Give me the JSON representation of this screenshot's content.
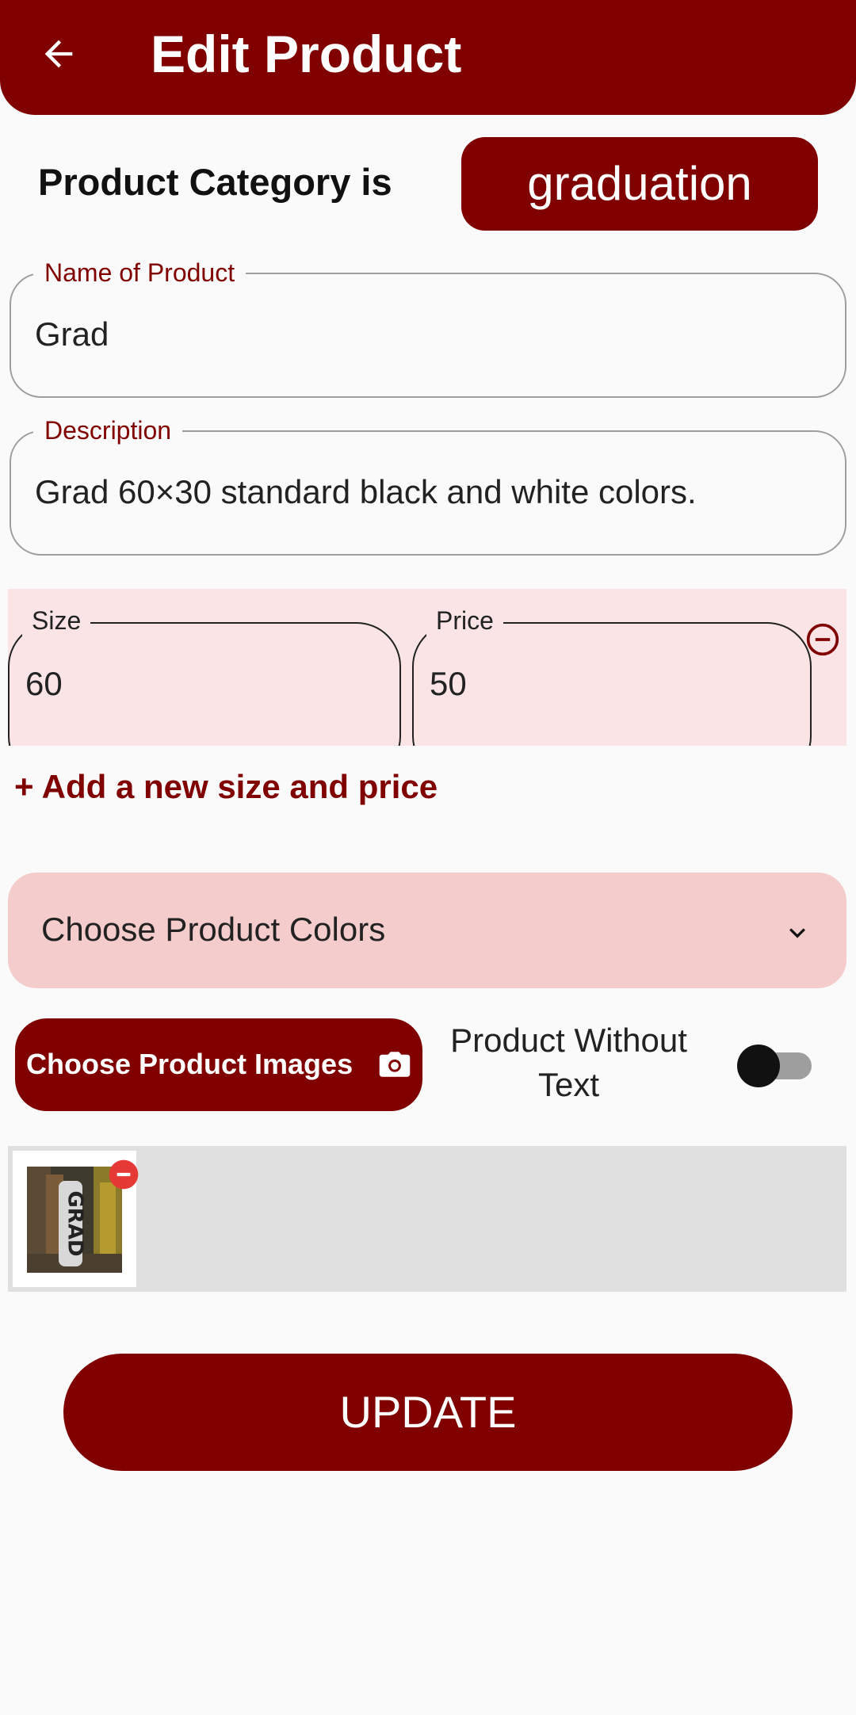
{
  "appbar": {
    "title": "Edit Product",
    "back_icon": "arrow-back-icon"
  },
  "category": {
    "label": "Product Category is",
    "value": "graduation"
  },
  "name_field": {
    "label": "Name of Product",
    "value": "Grad"
  },
  "description_field": {
    "label": "Description",
    "value": "Grad 60×30 standard black and white colors."
  },
  "size_price_rows": [
    {
      "size_label": "Size",
      "size_value": "60",
      "price_label": "Price",
      "price_value": "50"
    }
  ],
  "add_size_label": "+ Add a new size and price",
  "colors_dropdown": {
    "placeholder": "Choose Product Colors"
  },
  "images_button": {
    "label": "Choose Product Images",
    "icon": "camera-icon"
  },
  "without_text_toggle": {
    "label": "Product Without Text",
    "enabled": false
  },
  "images": [
    {
      "caption_text": "GRAD"
    }
  ],
  "update_button": {
    "label": "UPDATE"
  },
  "colors": {
    "primary": "#800000",
    "row_bg": "#fbe4e5",
    "dropdown_bg": "#f5cccc",
    "remove": "#e53935"
  }
}
